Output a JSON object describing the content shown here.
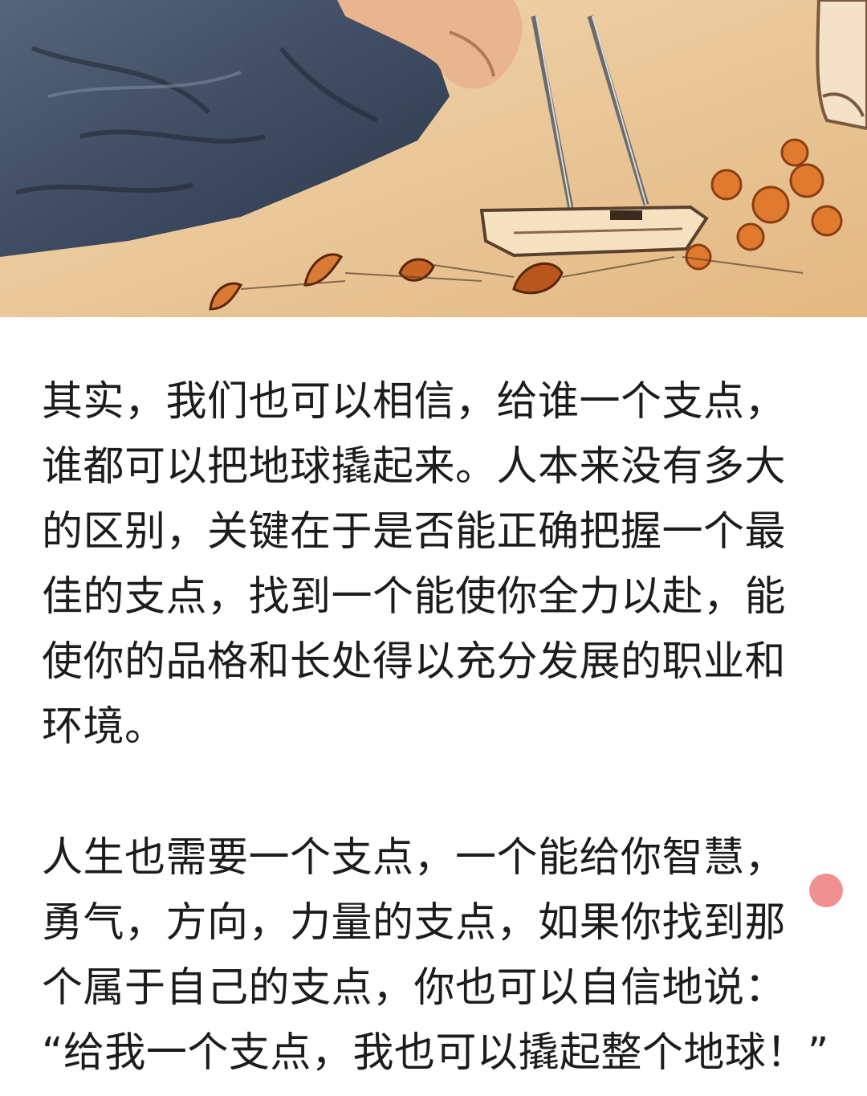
{
  "hero_image": {
    "alt": ""
  },
  "article": {
    "paragraph_1": {
      "lines": [
        "其实，我们也可以相信，给谁一个支点，",
        "谁都可以把地球撬起来。人本来没有多大",
        "的区别，关键在于是否能正确把握一个最",
        "佳的支点，找到一个能使你全力以赴，能",
        "使你的品格和长处得以充分发展的职业和",
        "环境。"
      ]
    },
    "paragraph_2": {
      "lines": [
        "人生也需要一个支点，一个能给你智慧，",
        "勇气，方向，力量的支点，如果你找到那",
        "个属于自己的支点，你也可以自信地说：",
        "“给我一个支点，我也可以撬起整个地球！”"
      ]
    }
  },
  "colors": {
    "text": "#1c1c1c",
    "background": "#ffffff",
    "float_button": "#f08a8a"
  }
}
